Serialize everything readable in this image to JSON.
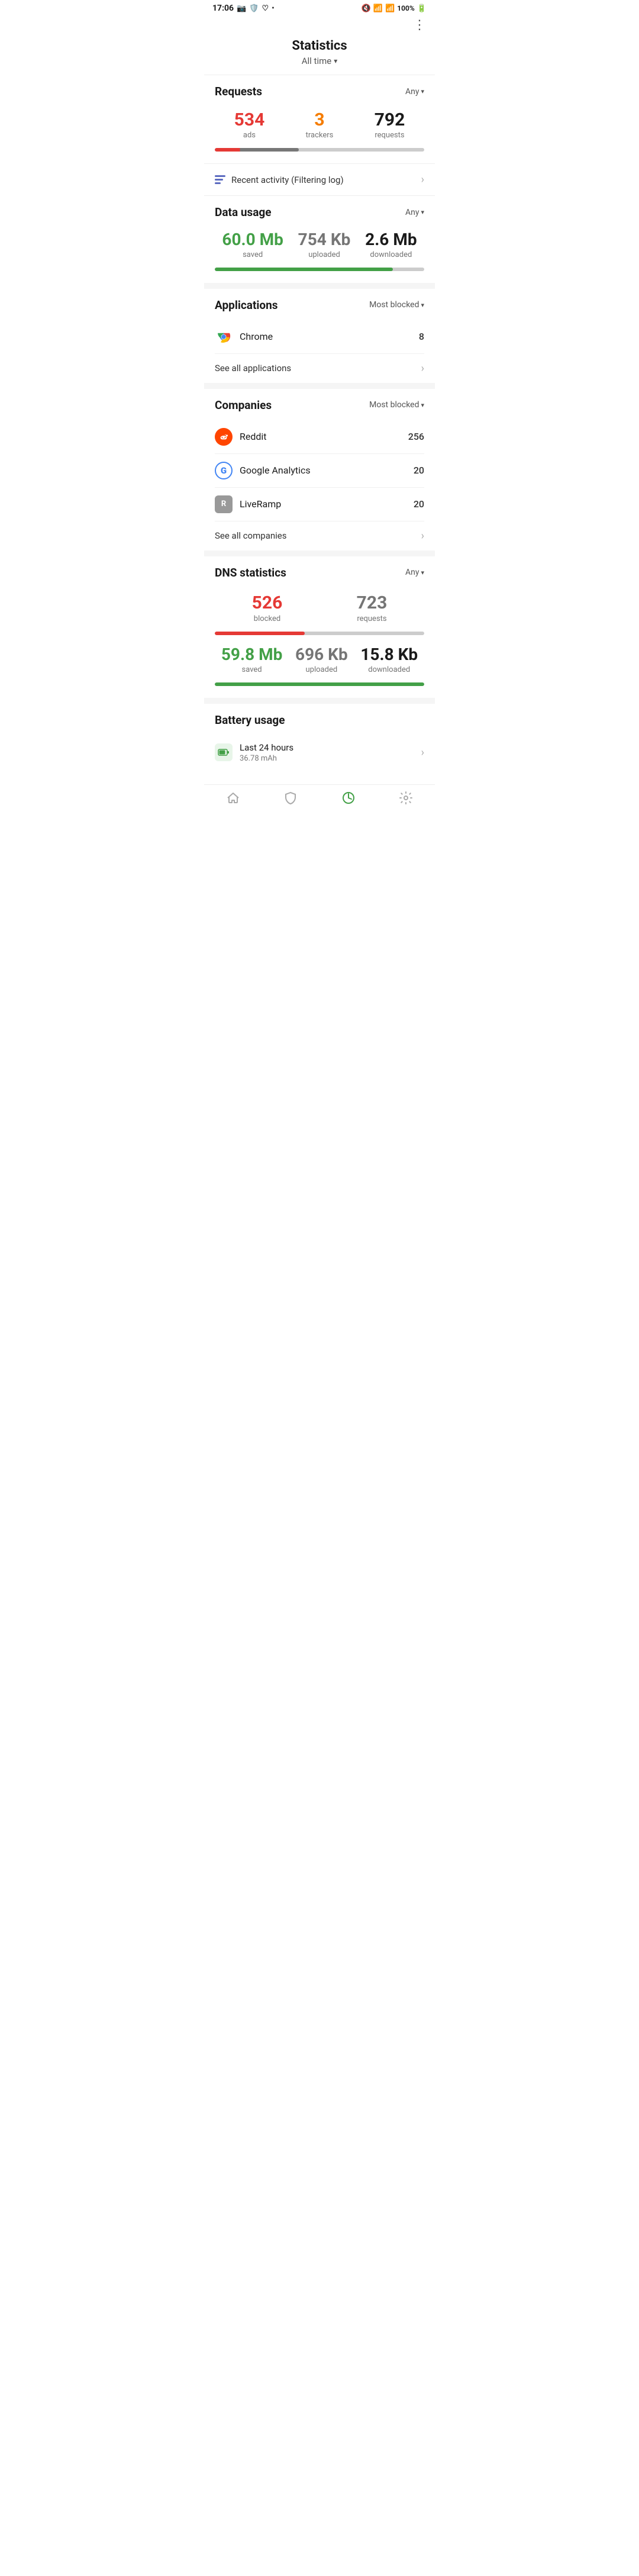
{
  "statusBar": {
    "time": "17:06",
    "icons": [
      "photo",
      "shield",
      "heart",
      "dot"
    ]
  },
  "pageTitle": "Statistics",
  "filterLabel": "All time",
  "requests": {
    "sectionTitle": "Requests",
    "filterLabel": "Any",
    "ads": {
      "value": "534",
      "label": "ads"
    },
    "trackers": {
      "value": "3",
      "label": "trackers"
    },
    "requests": {
      "value": "792",
      "label": "requests"
    },
    "progressAds": 40,
    "progressFull": 100
  },
  "recentActivity": {
    "text": "Recent activity (Filtering log)"
  },
  "dataUsage": {
    "sectionTitle": "Data usage",
    "filterLabel": "Any",
    "saved": {
      "value": "60.0 Mb",
      "label": "saved"
    },
    "uploaded": {
      "value": "754 Kb",
      "label": "uploaded"
    },
    "downloaded": {
      "value": "2.6 Mb",
      "label": "downloaded"
    },
    "progressFill": 85
  },
  "applications": {
    "sectionTitle": "Applications",
    "filterLabel": "Most blocked",
    "items": [
      {
        "name": "Chrome",
        "count": "8",
        "icon": "chrome"
      }
    ],
    "seeAllLabel": "See all applications"
  },
  "companies": {
    "sectionTitle": "Companies",
    "filterLabel": "Most blocked",
    "items": [
      {
        "name": "Reddit",
        "count": "256",
        "icon": "reddit"
      },
      {
        "name": "Google Analytics",
        "count": "20",
        "icon": "google"
      },
      {
        "name": "LiveRamp",
        "count": "20",
        "icon": "liveramp"
      }
    ],
    "seeAllLabel": "See all companies"
  },
  "dnsStats": {
    "sectionTitle": "DNS statistics",
    "filterLabel": "Any",
    "blocked": {
      "value": "526",
      "label": "blocked"
    },
    "requests": {
      "value": "723",
      "label": "requests"
    },
    "progressFill": 43,
    "saved": {
      "value": "59.8 Mb",
      "label": "saved"
    },
    "uploaded": {
      "value": "696 Kb",
      "label": "uploaded"
    },
    "downloaded": {
      "value": "15.8 Kb",
      "label": "downloaded"
    },
    "progressFill2": 100
  },
  "batteryUsage": {
    "sectionTitle": "Battery usage",
    "lastLabel": "Last 24 hours",
    "value": "36.78 mAh"
  },
  "bottomNav": {
    "items": [
      {
        "icon": "home",
        "label": "Home",
        "active": false
      },
      {
        "icon": "shield",
        "label": "Shield",
        "active": false
      },
      {
        "icon": "stats",
        "label": "Stats",
        "active": true
      },
      {
        "icon": "settings",
        "label": "Settings",
        "active": false
      }
    ]
  }
}
